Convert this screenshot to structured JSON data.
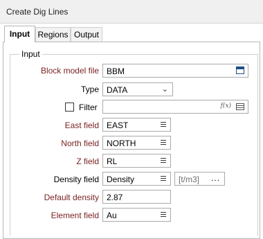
{
  "window": {
    "title": "Create Dig Lines"
  },
  "tabs": [
    {
      "label": "Input",
      "active": true
    },
    {
      "label": "Regions",
      "active": false
    },
    {
      "label": "Output",
      "active": false
    }
  ],
  "group": {
    "title": "Input"
  },
  "fields": {
    "block_model_file": {
      "label": "Block model file",
      "value": "BBM",
      "required": true
    },
    "type": {
      "label": "Type",
      "value": "DATA"
    },
    "filter": {
      "label": "Filter",
      "checked": false,
      "value": "",
      "fx": "f(x)"
    },
    "east_field": {
      "label": "East field",
      "value": "EAST",
      "required": true
    },
    "north_field": {
      "label": "North field",
      "value": "NORTH",
      "required": true
    },
    "z_field": {
      "label": "Z field",
      "value": "RL",
      "required": true
    },
    "density_field": {
      "label": "Density field",
      "value": "Density",
      "unit_placeholder": "[t/m3]",
      "unit_button": "..."
    },
    "default_density": {
      "label": "Default density",
      "value": "2.87",
      "required": true
    },
    "element_field": {
      "label": "Element field",
      "value": "Au",
      "required": true
    }
  }
}
